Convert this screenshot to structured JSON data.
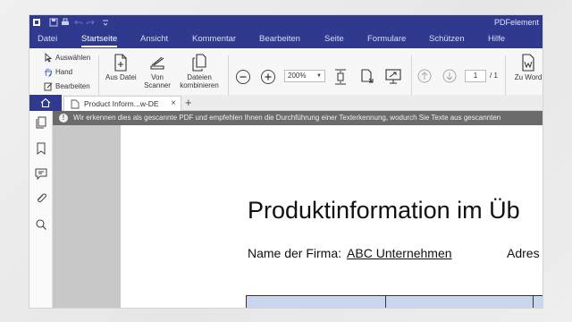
{
  "app": {
    "title": "PDFelement"
  },
  "menu": {
    "tabs": [
      "Datei",
      "Startseite",
      "Ansicht",
      "Kommentar",
      "Bearbeiten",
      "Seite",
      "Formulare",
      "Schützen",
      "Hilfe"
    ],
    "active": "Startseite"
  },
  "ribbon": {
    "select": "Auswählen",
    "hand": "Hand",
    "edit": "Bearbeiten",
    "from_file": "Aus Datei",
    "from_scanner_1": "Von",
    "from_scanner_2": "Scanner",
    "combine_1": "Dateien",
    "combine_2": "kombinieren",
    "zoom": "200%",
    "page_current": "1",
    "page_total": "/ 1",
    "to_word": "Zu Word"
  },
  "tabs": {
    "doc_title": "Product Inform...w-DE",
    "close": "×",
    "add": "+"
  },
  "notice": {
    "icon": "!",
    "text": "Wir erkennen dies als gescannte PDF und empfehlen Ihnen die Durchführung einer Texterkennung, wodurch Sie Texte aus gescannten"
  },
  "document": {
    "heading": "Produktinformation im Üb",
    "company_label": "Name der Firma:",
    "company_value": "ABC Unternehmen",
    "address_label": "Adres"
  },
  "colors": {
    "brand": "#2f3a8f",
    "notice_bg": "#6b6b6b",
    "table_header": "#c9d6ee"
  }
}
